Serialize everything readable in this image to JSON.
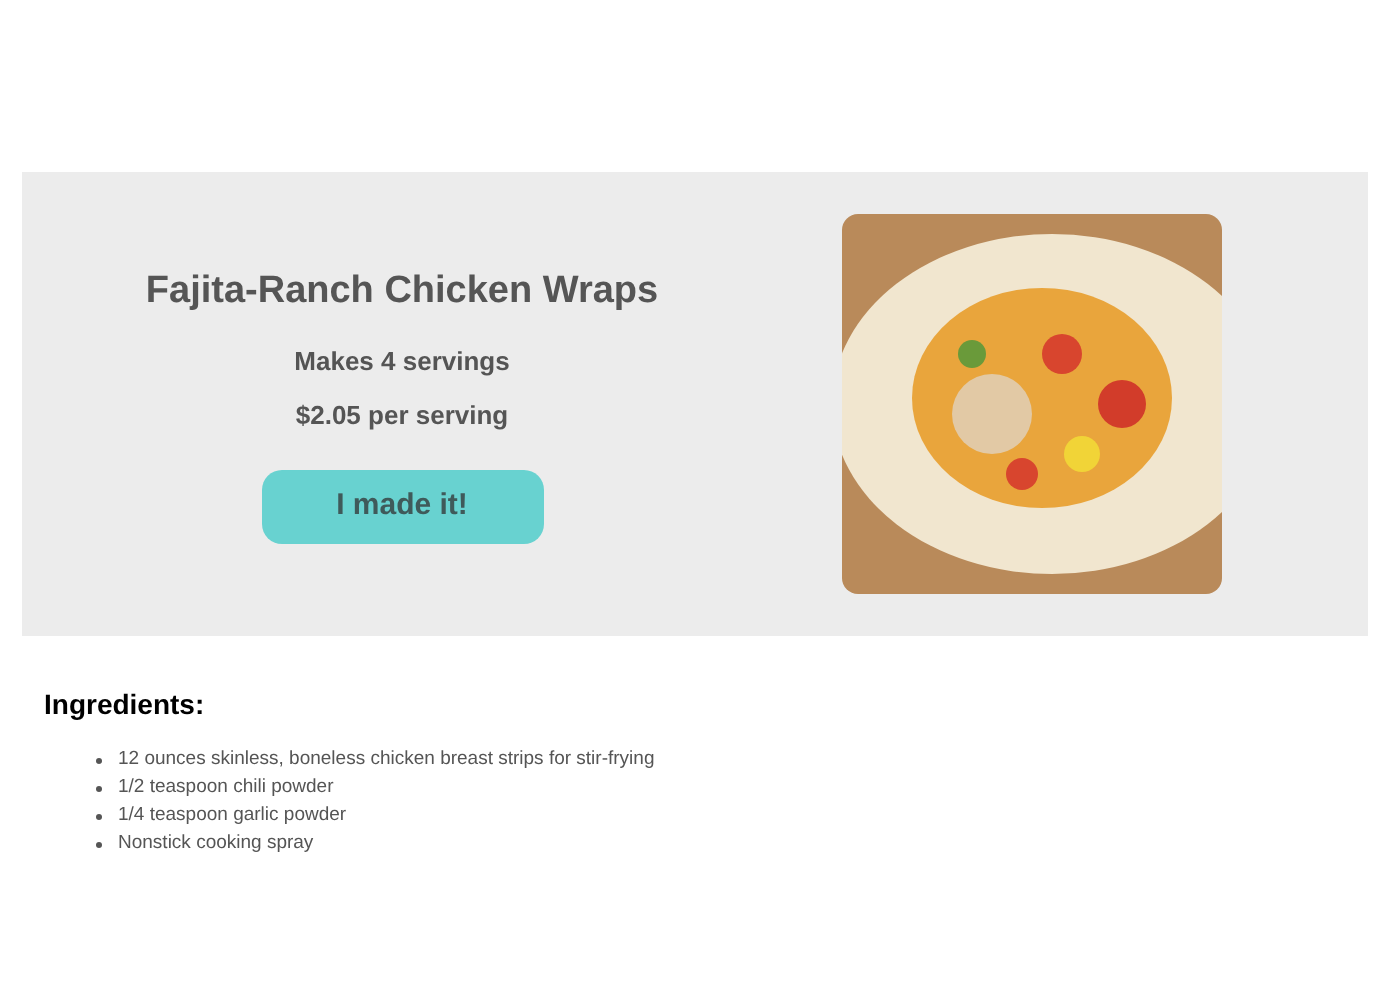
{
  "recipe": {
    "title": "Fajita-Ranch Chicken Wraps",
    "servings": "Makes 4 servings",
    "cost": "$2.05 per serving",
    "button": "I made it!"
  },
  "ingredients": {
    "heading": "Ingredients:",
    "items": [
      "12 ounces skinless, boneless chicken breast strips for stir-frying",
      "1/2 teaspoon chili powder",
      "1/4 teaspoon garlic powder",
      "Nonstick cooking spray"
    ]
  }
}
